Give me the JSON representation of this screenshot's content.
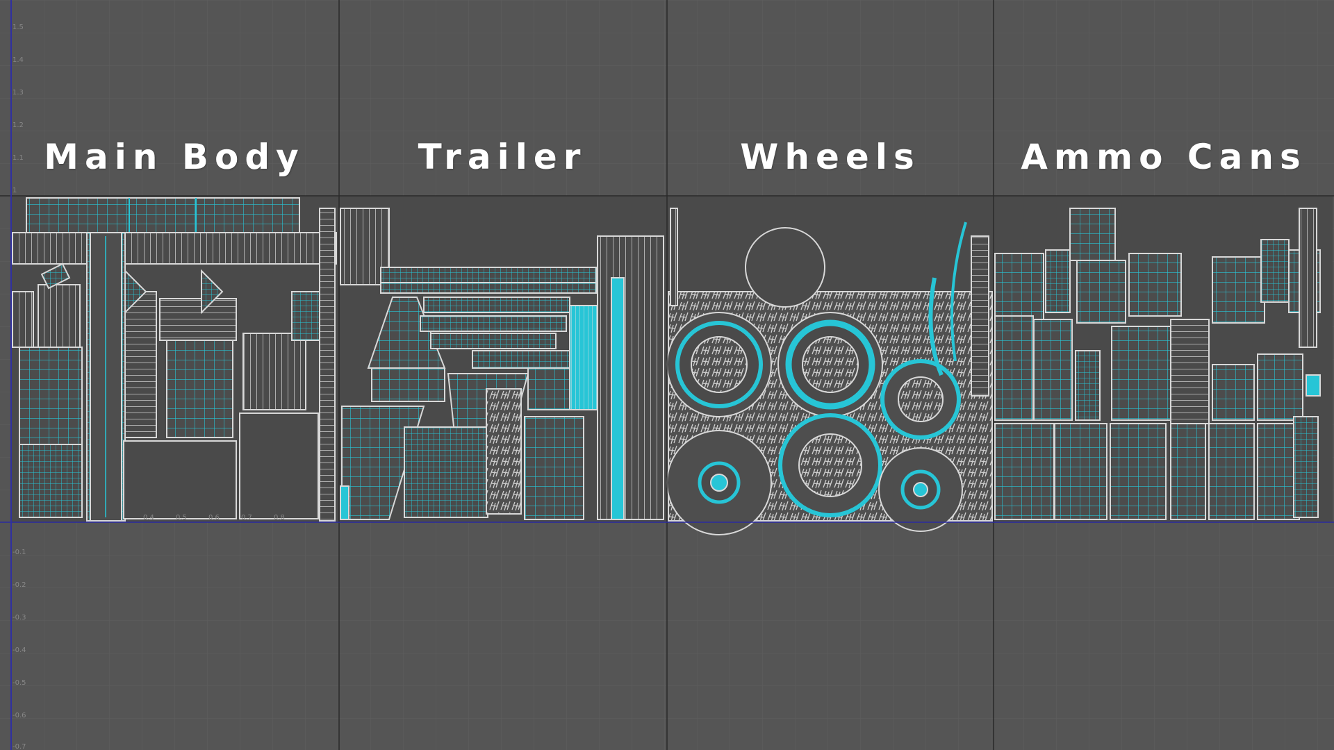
{
  "sections": [
    {
      "id": "main_body",
      "label": "Main Body"
    },
    {
      "id": "trailer",
      "label": "Trailer"
    },
    {
      "id": "wheels",
      "label": "Wheels"
    },
    {
      "id": "ammo_cans",
      "label": "Ammo Cans"
    }
  ],
  "axis": {
    "v_ticks": [
      "1.5",
      "1.4",
      "1.3",
      "1.2",
      "1.1",
      "1",
      "-0.1",
      "-0.2",
      "-0.3",
      "-0.4",
      "-0.5",
      "-0.6",
      "-0.7"
    ],
    "u_ticks": [
      "0.4",
      "0.5",
      "0.6",
      "0.7",
      "0.8"
    ]
  },
  "colors": {
    "background": "#555555",
    "grid_minor": "#5f5f5f",
    "grid_major": "#2a2a2a",
    "uv_shell_fill": "#4a4a4a",
    "uv_edge": "#d8d8d8",
    "uv_subdivision": "#27c5d6",
    "axis_v": "#3030a0"
  },
  "icons": {
    "uv_editor": "uv-shells-icon"
  }
}
